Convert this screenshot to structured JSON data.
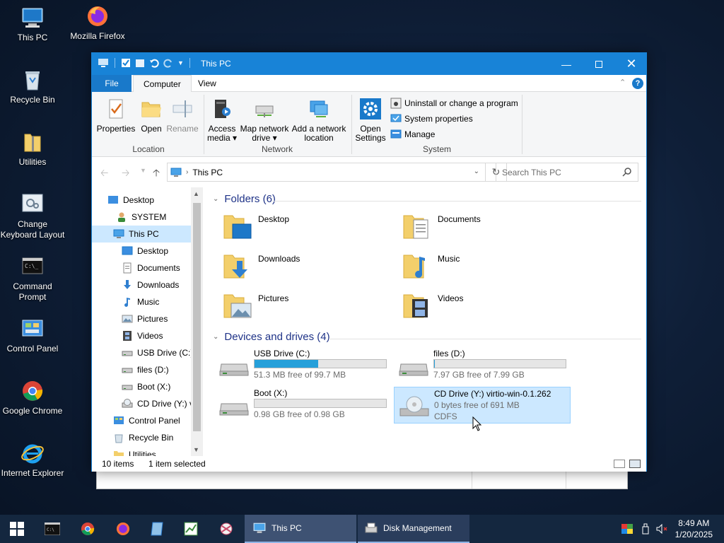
{
  "desktop": {
    "icons": [
      {
        "label": "This PC"
      },
      {
        "label": "Mozilla Firefox"
      },
      {
        "label": "Recycle Bin"
      },
      {
        "label": "Utilities"
      },
      {
        "label": "Change Keyboard Layout"
      },
      {
        "label": "Command Prompt"
      },
      {
        "label": "Control Panel"
      },
      {
        "label": "Google Chrome"
      },
      {
        "label": "Internet Explorer"
      }
    ]
  },
  "window": {
    "title": "This PC",
    "ribbon_tabs": [
      "File",
      "Computer",
      "View"
    ],
    "ribbon": {
      "location": {
        "label": "Location",
        "buttons": [
          "Properties",
          "Open",
          "Rename"
        ]
      },
      "network": {
        "label": "Network",
        "buttons": [
          "Access media",
          "Map network drive",
          "Add a network location"
        ]
      },
      "system": {
        "label": "System",
        "open_settings": "Open Settings",
        "small": [
          "Uninstall or change a program",
          "System properties",
          "Manage"
        ]
      }
    },
    "address": {
      "path": "This PC",
      "search_placeholder": "Search This PC"
    },
    "nav_pane": [
      {
        "label": "Desktop"
      },
      {
        "label": "SYSTEM"
      },
      {
        "label": "This PC"
      },
      {
        "label": "Desktop"
      },
      {
        "label": "Documents"
      },
      {
        "label": "Downloads"
      },
      {
        "label": "Music"
      },
      {
        "label": "Pictures"
      },
      {
        "label": "Videos"
      },
      {
        "label": "USB Drive (C:)"
      },
      {
        "label": "files (D:)"
      },
      {
        "label": "Boot (X:)"
      },
      {
        "label": "CD Drive (Y:) vi"
      },
      {
        "label": "Control Panel"
      },
      {
        "label": "Recycle Bin"
      },
      {
        "label": "Utilities"
      }
    ],
    "folders_header": "Folders (6)",
    "folders": [
      "Desktop",
      "Documents",
      "Downloads",
      "Music",
      "Pictures",
      "Videos"
    ],
    "devices_header": "Devices and drives (4)",
    "drives": [
      {
        "name": "USB Drive (C:)",
        "free": "51.3 MB free of 99.7 MB",
        "used_fraction": 0.486
      },
      {
        "name": "files (D:)",
        "free": "7.97 GB free of 7.99 GB",
        "used_fraction": 0.003
      },
      {
        "name": "Boot (X:)",
        "free": "0.98 GB free of 0.98 GB",
        "used_fraction": 0.0
      },
      {
        "name": "CD Drive (Y:) virtio-win-0.1.262",
        "free": "0 bytes free of 691 MB",
        "fs": "CDFS"
      }
    ],
    "status": {
      "items": "10 items",
      "selected": "1 item selected"
    }
  },
  "taskbar": {
    "tasks": [
      "This PC",
      "Disk Management"
    ],
    "time": "8:49 AM",
    "date": "1/20/2025"
  },
  "colors": {
    "accent": "#1883d7",
    "selection": "#cce8ff",
    "drive_fill": "#26a0da",
    "header_text": "#1e3287"
  }
}
